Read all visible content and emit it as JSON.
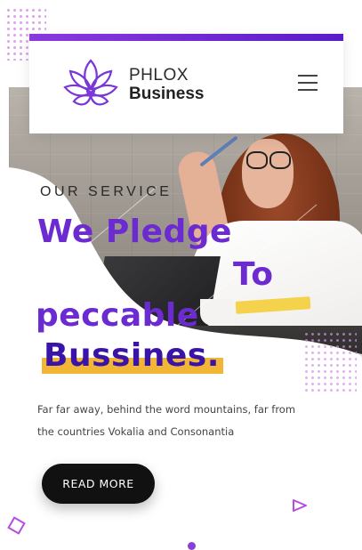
{
  "header": {
    "brand_top": "PHLOX",
    "brand_bottom": "Business",
    "logo_icon": "lotus-logo-icon",
    "menu_icon": "hamburger-menu-icon",
    "accent_gradient": [
      "#8a39e0",
      "#5a1cc8"
    ]
  },
  "hero": {
    "overline": "OUR SERVICE",
    "headline_line1": "We Pledge",
    "headline_line2": "To",
    "headline_line3": "peccable",
    "headline_line4": "Bussines.",
    "description": "Far far away, behind the word mountains, far from the countries Vokalia and Consonantia",
    "cta_label": "READ MORE"
  },
  "colors": {
    "headline": "#6b2bd0",
    "headline_dark": "#3a14a8",
    "highlight": "#f2b636",
    "button_bg": "#111111"
  }
}
